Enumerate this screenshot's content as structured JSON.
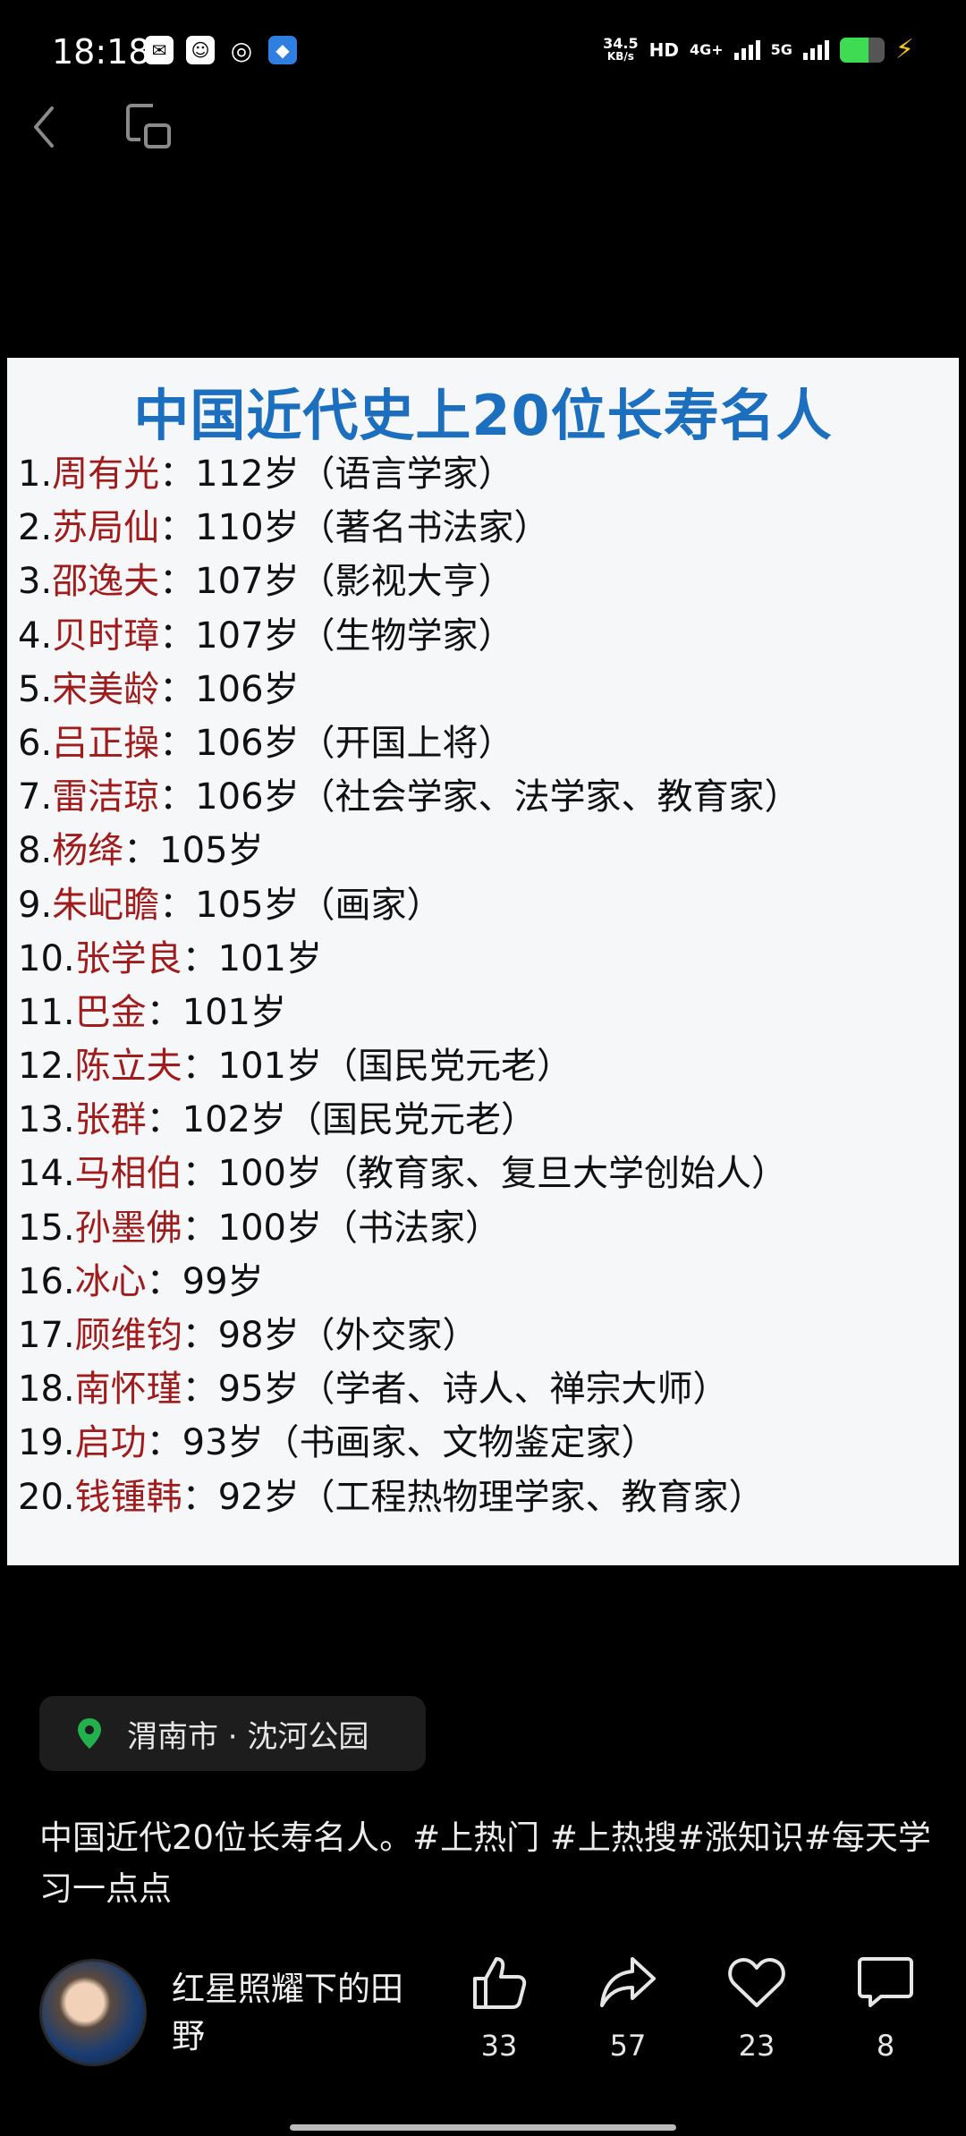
{
  "status_bar": {
    "time": "18:18",
    "speed_value": "34.5",
    "speed_unit": "KB/s",
    "hd_badge": "HD",
    "net_4g": "4G+",
    "net_5g": "5G",
    "battery_level": 0.64,
    "app_icons": [
      "wechat-icon",
      "avatar-app-icon",
      "swirl-app-icon",
      "blue-app-icon"
    ]
  },
  "post_image": {
    "title": "中国近代史上20位长寿名人",
    "entries": [
      {
        "num": "1.",
        "name": "周有光",
        "rest": "：112岁（语言学家）"
      },
      {
        "num": "2.",
        "name": "苏局仙",
        "rest": "：110岁（著名书法家）"
      },
      {
        "num": "3.",
        "name": "邵逸夫",
        "rest": "：107岁（影视大亨）"
      },
      {
        "num": "4.",
        "name": "贝时璋",
        "rest": "：107岁（生物学家）"
      },
      {
        "num": "5.",
        "name": "宋美龄",
        "rest": "：106岁"
      },
      {
        "num": "6.",
        "name": "吕正操",
        "rest": "：106岁（开国上将）"
      },
      {
        "num": "7.",
        "name": "雷洁琼",
        "rest": "：106岁（社会学家、法学家、教育家）"
      },
      {
        "num": "8.",
        "name": "杨绛",
        "rest": "：105岁"
      },
      {
        "num": "9.",
        "name": "朱屺瞻",
        "rest": "：105岁（画家）"
      },
      {
        "num": "10.",
        "name": "张学良",
        "rest": "：101岁"
      },
      {
        "num": "11.",
        "name": "巴金",
        "rest": "：101岁"
      },
      {
        "num": "12.",
        "name": "陈立夫",
        "rest": "：101岁（国民党元老）"
      },
      {
        "num": "13.",
        "name": "张群",
        "rest": "：102岁（国民党元老）"
      },
      {
        "num": "14.",
        "name": "马相伯",
        "rest": "：100岁（教育家、复旦大学创始人）"
      },
      {
        "num": "15.",
        "name": "孙墨佛",
        "rest": "：100岁（书法家）"
      },
      {
        "num": "16.",
        "name": "冰心",
        "rest": "：99岁"
      },
      {
        "num": "17.",
        "name": "顾维钧",
        "rest": "：98岁（外交家）"
      },
      {
        "num": "18.",
        "name": "南怀瑾",
        "rest": "：95岁（学者、诗人、禅宗大师）"
      },
      {
        "num": "19.",
        "name": "启功",
        "rest": "：93岁（书画家、文物鉴定家）"
      },
      {
        "num": "20.",
        "name": "钱锺韩",
        "rest": "：92岁（工程热物理学家、教育家）"
      }
    ]
  },
  "location": {
    "text": "渭南市 · 沈河公园"
  },
  "caption": "中国近代20位长寿名人。#上热门 #上热搜#涨知识#每天学习一点点",
  "author": {
    "name": "红星照耀下的田野"
  },
  "actions": {
    "likes": "33",
    "shares": "57",
    "favorites": "23",
    "comments": "8"
  },
  "colors": {
    "title_blue": "#1c6fbe",
    "name_red": "#a01b1b",
    "location_pin": "#22b14c"
  }
}
